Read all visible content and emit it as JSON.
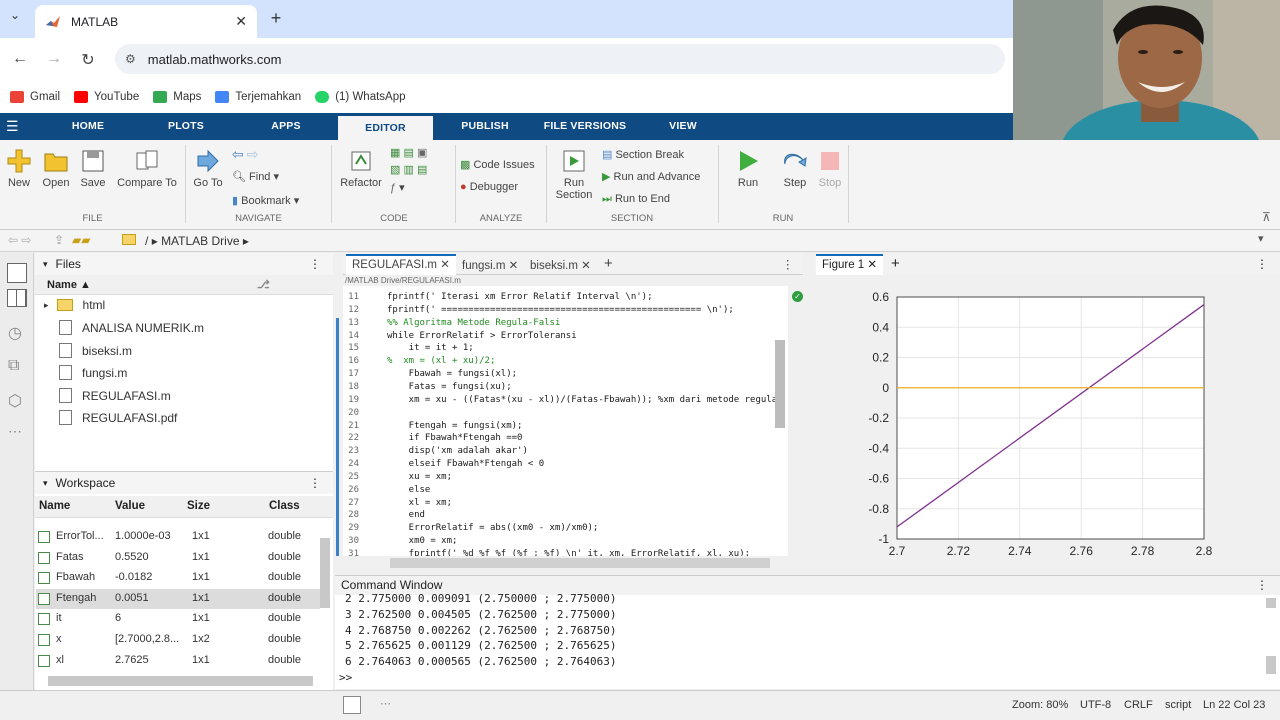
{
  "browser": {
    "tab_title": "MATLAB",
    "tab_close": "✕",
    "new_tab": "+",
    "url": "matlab.mathworks.com",
    "bookmarks": [
      "Gmail",
      "YouTube",
      "Maps",
      "Terjemahkan",
      "(1) WhatsApp"
    ]
  },
  "matlab_tabs": [
    "HOME",
    "PLOTS",
    "APPS",
    "EDITOR",
    "PUBLISH",
    "FILE VERSIONS",
    "VIEW"
  ],
  "ribbon": {
    "file": {
      "new": "New",
      "open": "Open",
      "save": "Save",
      "compare": "Compare To",
      "section": "FILE"
    },
    "navigate": {
      "goto": "Go To",
      "find": "Find",
      "bookmark": "Bookmark",
      "section": "NAVIGATE"
    },
    "code": {
      "refactor": "Refactor",
      "section": "CODE"
    },
    "analyze": {
      "code_issues": "Code Issues",
      "debugger": "Debugger",
      "section": "ANALYZE"
    },
    "section": {
      "run_section_l1": "Run",
      "run_section_l2": "Section",
      "section_break": "Section Break",
      "run_advance": "Run and Advance",
      "run_end": "Run to End",
      "section": "SECTION"
    },
    "run": {
      "run": "Run",
      "step": "Step",
      "stop": "Stop",
      "section": "RUN"
    }
  },
  "path": {
    "sep": "/",
    "drive": "MATLAB Drive",
    "arrow": "▸"
  },
  "files": {
    "title": "Files",
    "col_name": "Name ▲",
    "items": [
      "html",
      "ANALISA NUMERIK.m",
      "biseksi.m",
      "fungsi.m",
      "REGULAFASI.m",
      "REGULAFASI.pdf"
    ]
  },
  "workspace": {
    "title": "Workspace",
    "headers": [
      "Name",
      "Value",
      "Size",
      "Class"
    ],
    "rows": [
      {
        "name": "ErrorTol...",
        "value": "1.0000e-03",
        "size": "1x1",
        "class": "double"
      },
      {
        "name": "Fatas",
        "value": "0.5520",
        "size": "1x1",
        "class": "double"
      },
      {
        "name": "Fbawah",
        "value": "-0.0182",
        "size": "1x1",
        "class": "double"
      },
      {
        "name": "Ftengah",
        "value": "0.0051",
        "size": "1x1",
        "class": "double"
      },
      {
        "name": "it",
        "value": "6",
        "size": "1x1",
        "class": "double"
      },
      {
        "name": "x",
        "value": "[2.7000,2.8...",
        "size": "1x2",
        "class": "double"
      },
      {
        "name": "xl",
        "value": "2.7625",
        "size": "1x1",
        "class": "double"
      }
    ]
  },
  "editor": {
    "tabs": [
      "REGULAFASI.m",
      "fungsi.m",
      "biseksi.m"
    ],
    "breadcrumb": "/MATLAB Drive/REGULAFASI.m",
    "lines": [
      {
        "n": "11",
        "t": "fprintf(' Iterasi xm Error Relatif Interval \\n');"
      },
      {
        "n": "12",
        "t": "fprintf(' ================================================ \\n');"
      },
      {
        "n": "13",
        "t": "%% Algoritma Metode Regula-Falsi"
      },
      {
        "n": "14",
        "t": "while ErrorRelatif > ErrorToleransi"
      },
      {
        "n": "15",
        "t": "    it = it + 1;"
      },
      {
        "n": "16",
        "t": "%  xm = (xl + xu)/2;"
      },
      {
        "n": "17",
        "t": "    Fbawah = fungsi(xl);"
      },
      {
        "n": "18",
        "t": "    Fatas = fungsi(xu);"
      },
      {
        "n": "19",
        "t": "    xm = xu - ((Fatas*(xu - xl))/(Fatas-Fbawah)); %xm dari metode regula-"
      },
      {
        "n": "20",
        "t": ""
      },
      {
        "n": "21",
        "t": "    Ftengah = fungsi(xm);"
      },
      {
        "n": "22",
        "t": "    if Fbawah*Ftengah ==0"
      },
      {
        "n": "23",
        "t": "    disp('xm adalah akar')"
      },
      {
        "n": "24",
        "t": "    elseif Fbawah*Ftengah < 0"
      },
      {
        "n": "25",
        "t": "    xu = xm;"
      },
      {
        "n": "26",
        "t": "    else"
      },
      {
        "n": "27",
        "t": "    xl = xm;"
      },
      {
        "n": "28",
        "t": "    end"
      },
      {
        "n": "29",
        "t": "    ErrorRelatif = abs((xm0 - xm)/xm0);"
      },
      {
        "n": "30",
        "t": "    xm0 = xm;"
      },
      {
        "n": "31",
        "t": "    fprintf(' %d %f %f (%f ; %f) \\n' it, xm, ErrorRelatif, xl, xu);"
      }
    ]
  },
  "figure": {
    "tab": "Figure 1"
  },
  "chart_data": {
    "type": "line",
    "xlim": [
      2.7,
      2.8
    ],
    "ylim": [
      -1,
      0.6
    ],
    "xticks": [
      "2.7",
      "2.72",
      "2.74",
      "2.76",
      "2.78",
      "2.8"
    ],
    "yticks": [
      "0.6",
      "0.4",
      "0.2",
      "0",
      "-0.2",
      "-0.4",
      "-0.6",
      "-0.8",
      "-1"
    ],
    "grid": true,
    "series": [
      {
        "color": "#7e2f8e",
        "x": [
          2.7,
          2.8
        ],
        "y": [
          -0.92,
          0.55
        ]
      },
      {
        "color": "#edb120",
        "x": [
          2.7,
          2.8
        ],
        "y": [
          0,
          0
        ]
      }
    ]
  },
  "command": {
    "title": "Command Window",
    "lines": [
      "2 2.775000 0.009091 (2.750000 ; 2.775000)",
      "3 2.762500 0.004505 (2.762500 ; 2.775000)",
      "4 2.768750 0.002262 (2.762500 ; 2.768750)",
      "5 2.765625 0.001129 (2.762500 ; 2.765625)",
      "6 2.764063 0.000565 (2.762500 ; 2.764063)"
    ],
    "prompt": ">>"
  },
  "status": {
    "zoom": "Zoom: 80%",
    "encoding": "UTF-8",
    "eol": "CRLF",
    "mode": "script",
    "pos": "Ln 22 Col 23"
  }
}
